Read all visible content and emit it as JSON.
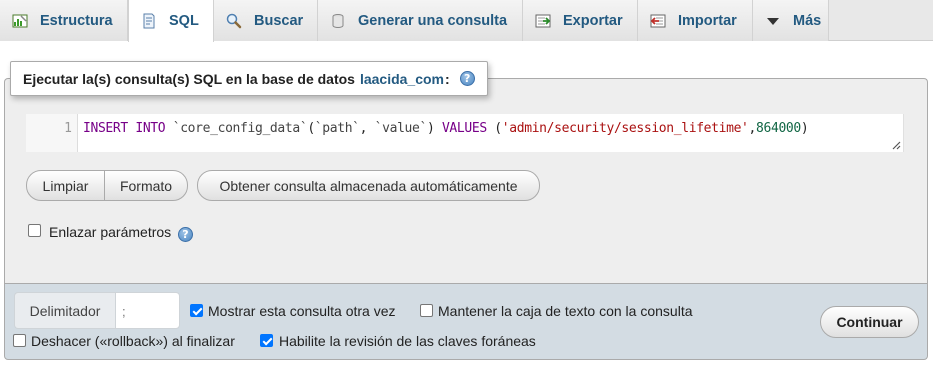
{
  "tabs": [
    {
      "label": "Estructura",
      "icon": "structure-icon"
    },
    {
      "label": "SQL",
      "icon": "sql-icon"
    },
    {
      "label": "Buscar",
      "icon": "search-icon"
    },
    {
      "label": "Generar una consulta",
      "icon": "query-icon"
    },
    {
      "label": "Exportar",
      "icon": "export-icon"
    },
    {
      "label": "Importar",
      "icon": "import-icon"
    },
    {
      "label": "Más",
      "icon": "triangle-down-icon"
    }
  ],
  "active_tab": "SQL",
  "legend": {
    "prefix": "Ejecutar la(s) consulta(s) SQL en la base de datos",
    "database": "laacida_com",
    "suffix": ":"
  },
  "editor": {
    "line_number": "1",
    "tokens": {
      "t1": "INSERT INTO",
      "t2": " `core_config_data`",
      "t3": "(",
      "t4": "`path`",
      "t5": ", ",
      "t6": "`value`",
      "t7": ") ",
      "t8": "VALUES",
      "t9": " (",
      "t10": "'admin/security/session_lifetime'",
      "t11": ",",
      "t12": "864000",
      "t13": ")"
    }
  },
  "buttons": {
    "clear": "Limpiar",
    "format": "Formato",
    "autosaved": "Obtener consulta almacenada automáticamente",
    "go": "Continuar"
  },
  "bind_params": {
    "label": "Enlazar parámetros",
    "checked": false
  },
  "delimiter": {
    "label": "Delimitador",
    "value": ";"
  },
  "options": {
    "show_query": {
      "label": "Mostrar esta consulta otra vez",
      "checked": true
    },
    "retain_box": {
      "label": "Mantener la caja de texto con la consulta",
      "checked": false
    },
    "rollback": {
      "label": "Deshacer («rollback») al finalizar",
      "checked": false
    },
    "fk_checks": {
      "label": "Habilite la revisión de las claves foráneas",
      "checked": true
    }
  },
  "colors": {
    "link": "#235a81",
    "panel_bg": "#eeeeee",
    "bottom_bg": "#d3dce3",
    "checkbox_checked": "#0075ff"
  }
}
